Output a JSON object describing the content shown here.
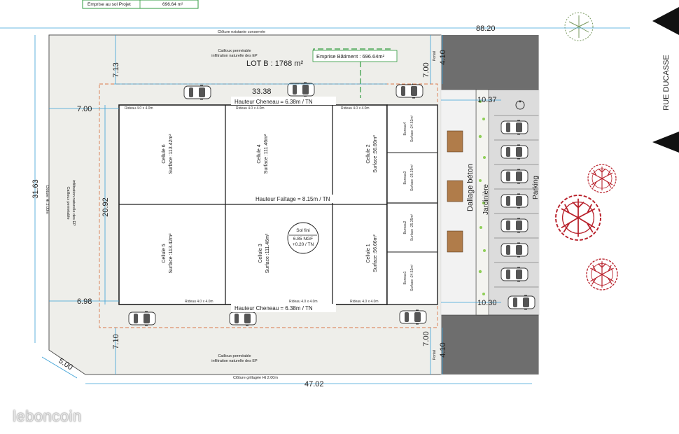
{
  "header": {
    "emprise_label": "Emprise au sol Projet",
    "emprise_value": "696.64 m²"
  },
  "lot": {
    "title": "LOT B : 1768 m²",
    "emprise_batiment": "Emprise Bâtiment : 696.64m²",
    "cailloux_top": [
      "Cailloux perméable",
      "infiltration naturelle des EP"
    ],
    "cailloux_bottom": [
      "Cailloux perméable",
      "infiltration naturelle des EP"
    ],
    "cailloux_left": [
      "Cailloux perméable",
      "infiltration naturelle des EP"
    ],
    "cloture_top": "Clôture existante conservée",
    "cloture_bottom": "Clôture grillagée Ht 2.00m",
    "cloture_left": "Clôture Ht 2.00m"
  },
  "street": {
    "name": "RUE DUCASSE"
  },
  "dimensions": {
    "top_total": "88.20",
    "bottom_total": "47.02",
    "left_total": "31.63",
    "building_width": "33.38",
    "building_height": "20.92",
    "setback_top_left": "7.13",
    "setback_left_top": "7.00",
    "setback_left_bottom": "6.98",
    "setback_bottom_left": "7.10",
    "setback_top_right": "7.00",
    "setback_top_right2": "4.10",
    "setback_bottom_right": "7.00",
    "setback_bottom_right2": "4.10",
    "corner_diag": "5.00",
    "parking_top": "10.37",
    "parking_bottom": "10.30"
  },
  "building": {
    "cells": [
      {
        "name": "Cellule 6",
        "surface": "Surface :113.42m²"
      },
      {
        "name": "Cellule 4",
        "surface": "Surface :111.46m²"
      },
      {
        "name": "Cellule 2",
        "surface": "Surface :56.66m²"
      },
      {
        "name": "Cellule 5",
        "surface": "Surface :113.42m²"
      },
      {
        "name": "Cellule 3",
        "surface": "Surface :111.46m²"
      },
      {
        "name": "Cellule 1",
        "surface": "Surface :56.66m²"
      }
    ],
    "offices": [
      {
        "name": "Bureau4",
        "surface": "Surface :24.52m²"
      },
      {
        "name": "Bureau3",
        "surface": "Surface :25.35m²"
      },
      {
        "name": "Bureau2",
        "surface": "Surface :25.35m²"
      },
      {
        "name": "Bureau1",
        "surface": "Surface :24.52m²"
      }
    ],
    "rideau": "Rideau 4.0 x 4.0m",
    "hauteur_cheneau_top": "Hauteur Cheneau = 6.38m / TN",
    "hauteur_cheneau_bottom": "Hauteur Cheneau = 6.38m / TN",
    "hauteur_faitage": "Hauteur Faîtage = 8.15m / TN",
    "sol_fini": [
      "Sol fini",
      "6.85 NGF",
      "+0.20 / TN"
    ]
  },
  "right_zone": {
    "dallage": "Dallage béton",
    "jardiniere": "Jardinière",
    "parking": "Parking",
    "portail": "Portail"
  },
  "watermark": "leboncoin",
  "colors": {
    "gravel": "#eeeeea",
    "road": "#6e6e6e",
    "parking": "#dcdcdc",
    "tree_red": "#b8202a",
    "tree_green": "#7a9a60",
    "setback_line": "#d9784a",
    "dim_line": "#3aa0d6",
    "emprise_line": "#2e9a3c"
  }
}
